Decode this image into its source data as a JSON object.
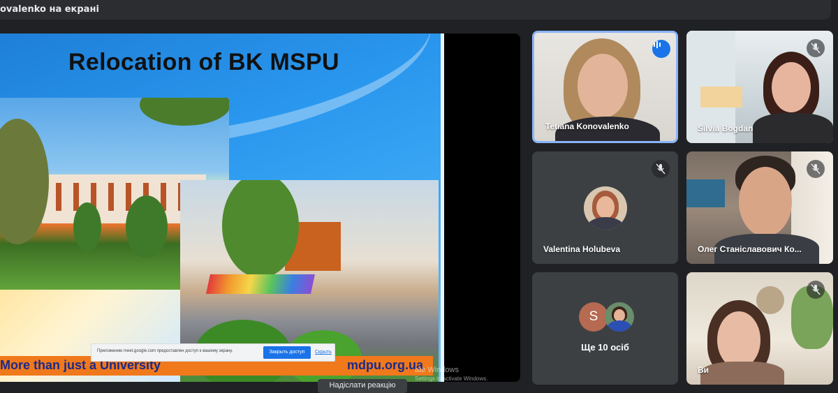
{
  "header": {
    "presenting_label": "ovalenko на екрані"
  },
  "slide": {
    "title": "Relocation of BK MSPU",
    "footer_left": "More than just a University",
    "footer_right": "mdpu.org.ua"
  },
  "share_bar": {
    "message": "Приложению meet.google.com предоставлен доступ к вашему экрану.",
    "stop_label": "Закрыть доступ",
    "hide_label": "Скрыть"
  },
  "activation_watermark": {
    "line1": "ate Windows",
    "line2": "Settings to activate Windows."
  },
  "participants": [
    {
      "name": "Tetiana Konovalenko",
      "speaking": true
    },
    {
      "name": "Silvia Bogdan",
      "muted": true
    },
    {
      "name": "Valentina Holubeva",
      "muted": true
    },
    {
      "name": "Олег Станіславович Ко...",
      "muted": true
    },
    {
      "name": "Ви",
      "muted": true
    }
  ],
  "others": {
    "initial": "S",
    "label": "Ще 10 осіб"
  },
  "reaction_button": {
    "label": "Надіслати реакцію"
  },
  "colors": {
    "speaking_border": "#8ab4f8",
    "accent": "#1a73e8",
    "tile_bg": "#3c4043"
  }
}
